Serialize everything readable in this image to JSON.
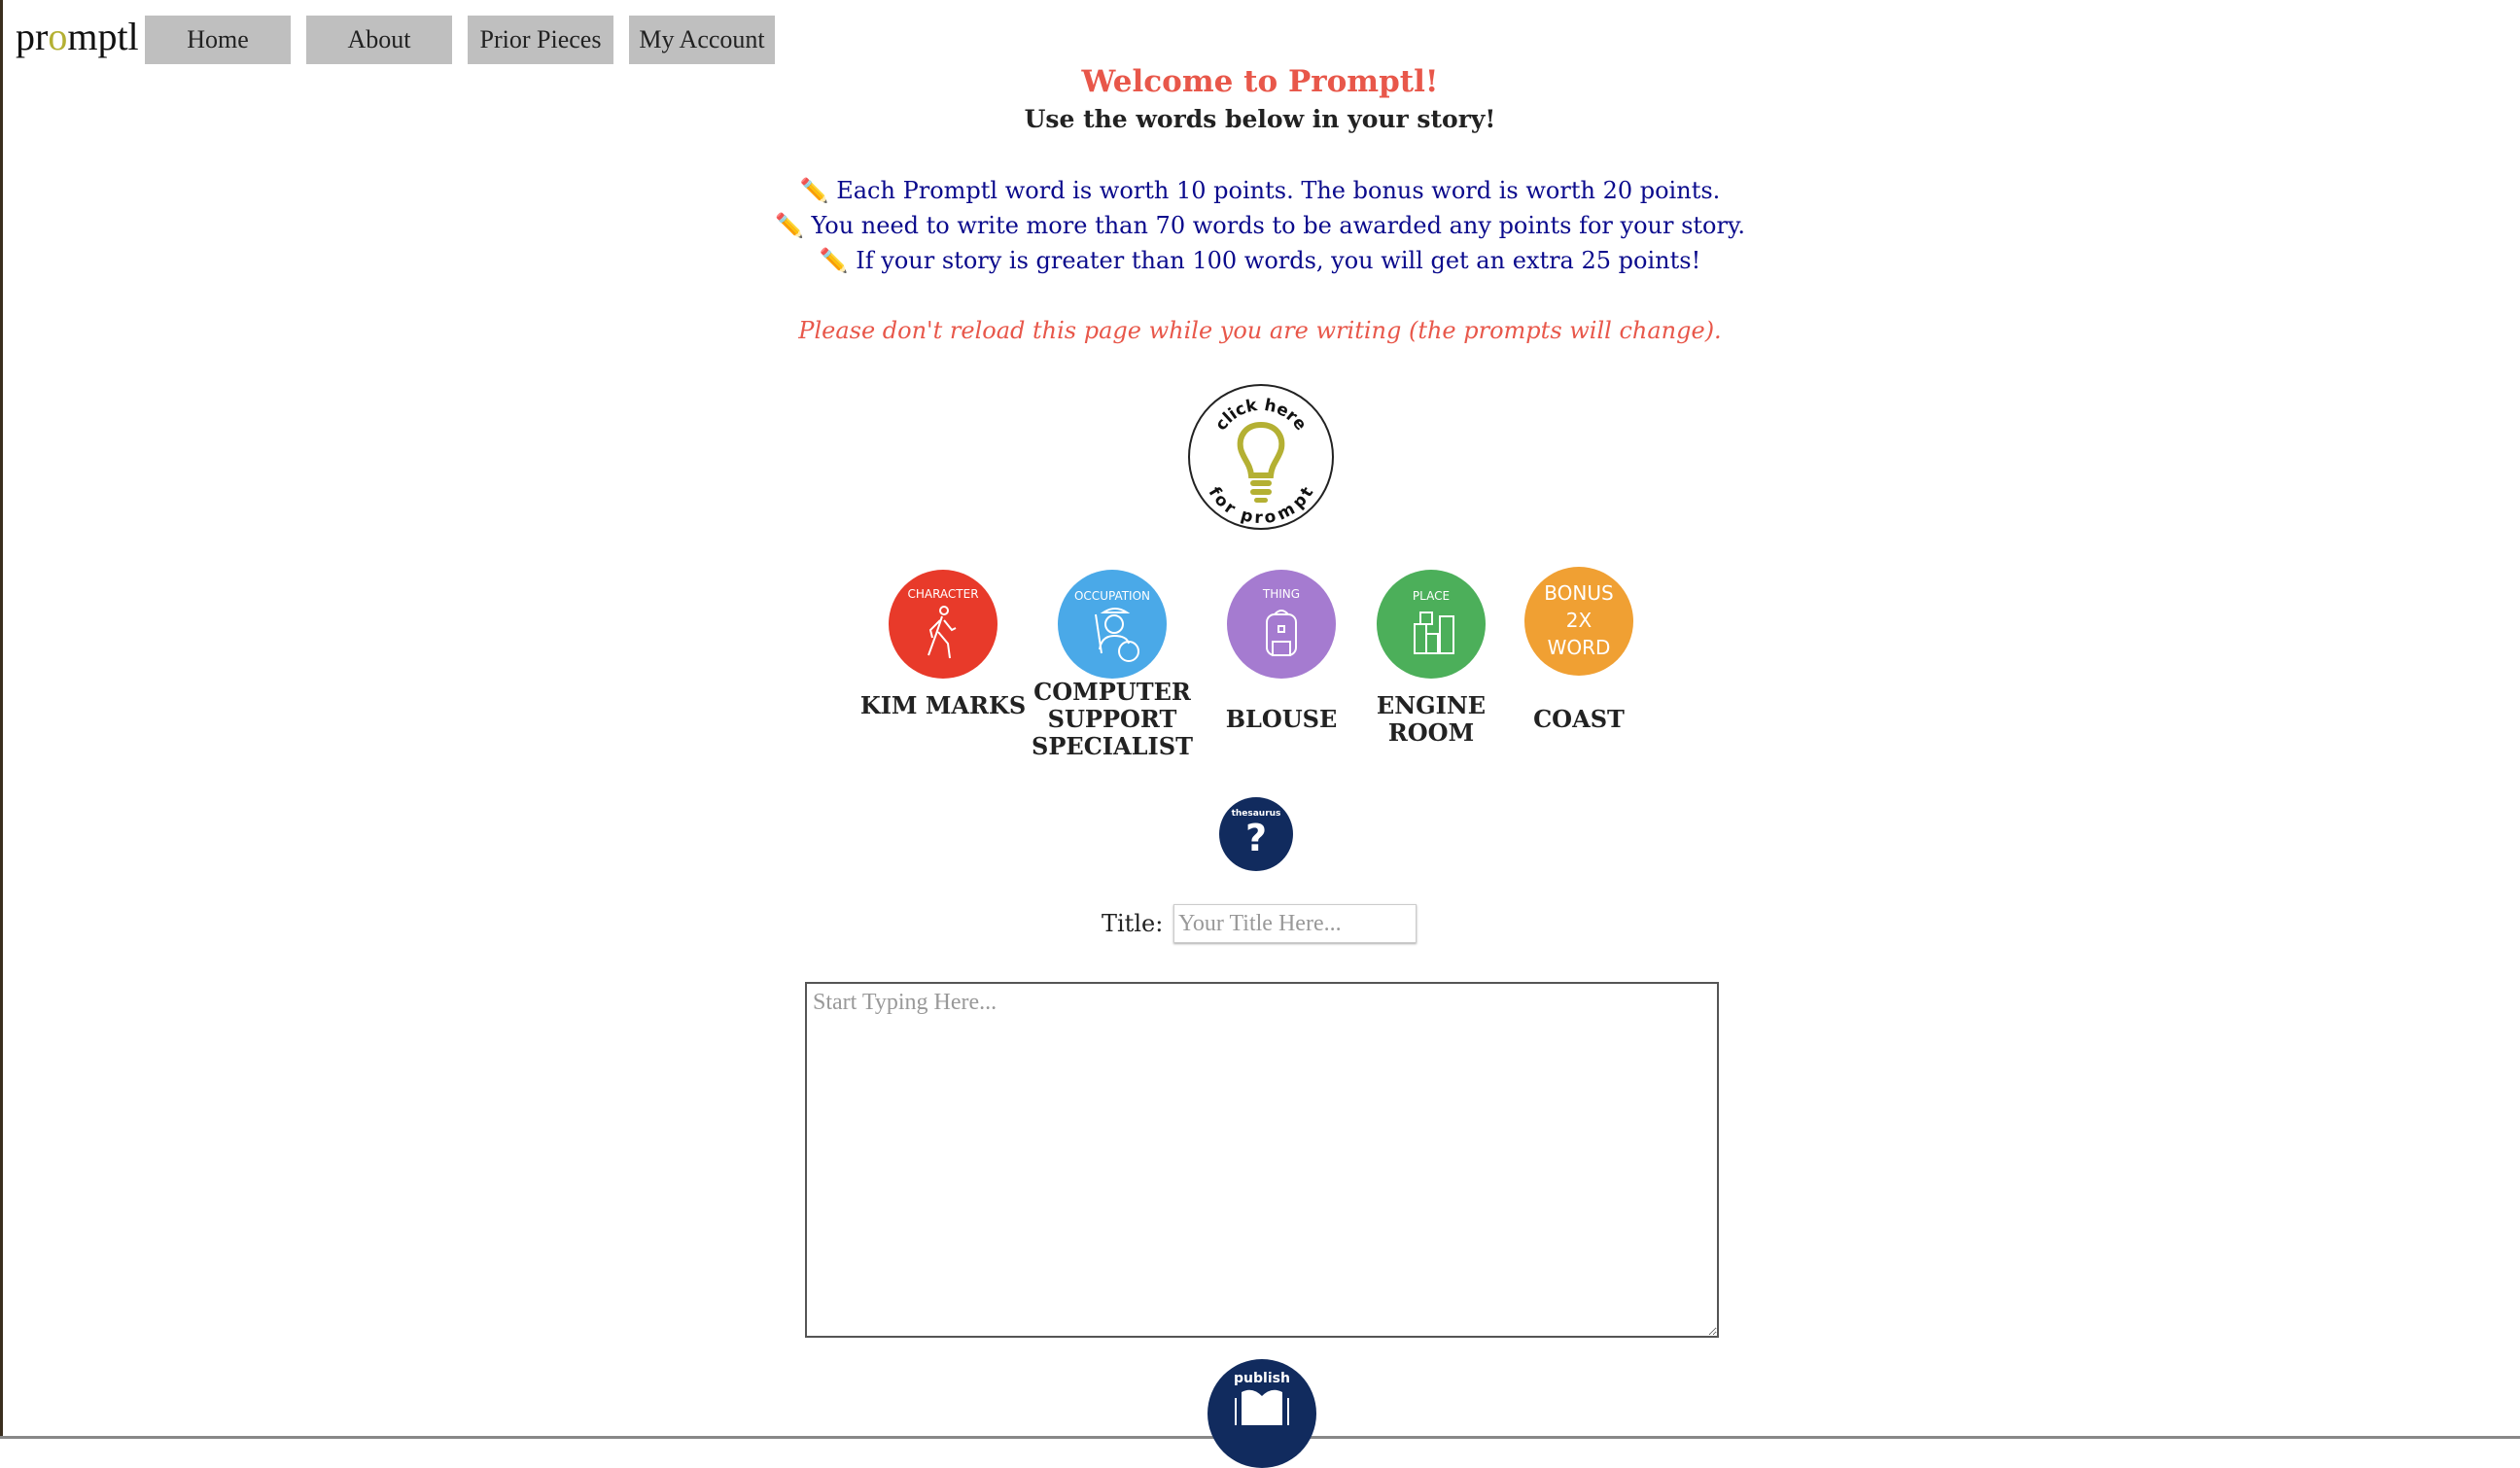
{
  "logo": "promptl",
  "nav": [
    {
      "label": "Home"
    },
    {
      "label": "About"
    },
    {
      "label": "Prior Pieces"
    },
    {
      "label": "My Account"
    }
  ],
  "header": {
    "welcome": "Welcome to Promptl!",
    "subtitle": "Use the words below in your story!"
  },
  "rules": [
    "✏️ Each Promptl word is worth 10 points. The bonus word is worth 20 points.",
    "✏️ You need to write more than 70 words to be awarded any points for your story.",
    "✏️ If your story is greater than 100 words, you will get an extra 25 points!"
  ],
  "warning": "Please don't reload this page while you are writing (the prompts will change).",
  "prompt_button": {
    "top": "click here",
    "bottom": "for prompt",
    "icon": "lightbulb-icon"
  },
  "prompts": [
    {
      "category": "CHARACTER",
      "word": "KIM MARKS",
      "color": "#e83a2a",
      "icon": "walking-person-icon"
    },
    {
      "category": "OCCUPATION",
      "word": "COMPUTER SUPPORT SPECIALIST",
      "color": "#4aa9e8",
      "icon": "painter-icon"
    },
    {
      "category": "THING",
      "word": "BLOUSE",
      "color": "#a57bd0",
      "icon": "backpack-icon"
    },
    {
      "category": "PLACE",
      "word": "ENGINE ROOM",
      "color": "#4caf5a",
      "icon": "buildings-icon"
    },
    {
      "category": "BONUS 2X WORD",
      "word": "COAST",
      "color": "#f0a033",
      "icon": ""
    }
  ],
  "thesaurus": {
    "label": "thesaurus",
    "icon": "question-mark-icon"
  },
  "form": {
    "title_label": "Title:",
    "title_placeholder": "Your Title Here...",
    "title_value": "",
    "story_placeholder": "Start Typing Here...",
    "story_value": ""
  },
  "publish": {
    "label": "publish",
    "icon": "open-book-icon"
  }
}
